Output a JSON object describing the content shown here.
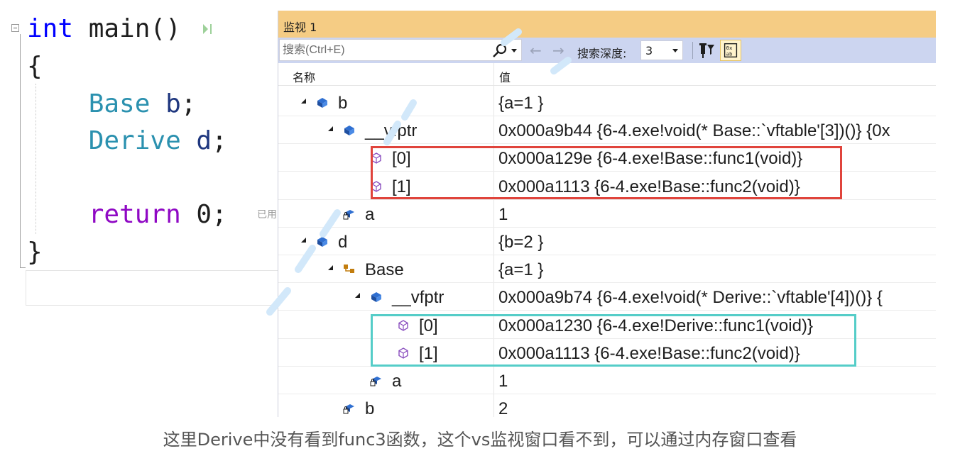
{
  "editor": {
    "lines": [
      {
        "parts": [
          {
            "t": "int",
            "c": "kw"
          },
          {
            "t": " main()",
            "c": "plain"
          }
        ]
      },
      {
        "parts": [
          {
            "t": "{",
            "c": "plain"
          }
        ]
      },
      {
        "parts": [
          {
            "t": "    Base",
            "c": "type"
          },
          {
            "t": " b",
            "c": "ident"
          },
          {
            "t": ";",
            "c": "plain"
          }
        ]
      },
      {
        "parts": [
          {
            "t": "    Derive",
            "c": "type"
          },
          {
            "t": " d",
            "c": "ident"
          },
          {
            "t": ";",
            "c": "plain"
          }
        ]
      },
      {
        "parts": [
          {
            "t": "",
            "c": "plain"
          }
        ]
      },
      {
        "parts": [
          {
            "t": "    return",
            "c": "kw2"
          },
          {
            "t": " 0;",
            "c": "plain"
          }
        ]
      },
      {
        "parts": [
          {
            "t": "}",
            "c": "plain"
          }
        ]
      }
    ],
    "hint_text": "已用"
  },
  "watch": {
    "title": "监视 1",
    "search": {
      "placeholder": "搜索(Ctrl+E)"
    },
    "search_depth_label": "搜索深度:",
    "search_depth_value": "3",
    "columns": {
      "name": "名称",
      "value": "值"
    },
    "rows": [
      {
        "indent": 0,
        "expanded": true,
        "icon": "object-icon",
        "name": "b",
        "value": "{a=1 }"
      },
      {
        "indent": 1,
        "expanded": true,
        "icon": "object-icon",
        "name": "__vfptr",
        "value": "0x000a9b44 {6-4.exe!void(* Base::`vftable'[3])()} {0x"
      },
      {
        "indent": 2,
        "expanded": null,
        "icon": "method-icon",
        "name": "[0]",
        "value": "0x000a129e {6-4.exe!Base::func1(void)}"
      },
      {
        "indent": 2,
        "expanded": null,
        "icon": "method-icon",
        "name": "[1]",
        "value": "0x000a1113 {6-4.exe!Base::func2(void)}"
      },
      {
        "indent": 1,
        "expanded": null,
        "icon": "field-icon",
        "name": "a",
        "value": "1"
      },
      {
        "indent": 0,
        "expanded": true,
        "icon": "object-icon",
        "name": "d",
        "value": "{b=2 }"
      },
      {
        "indent": 1,
        "expanded": true,
        "icon": "base-class-icon",
        "name": "Base",
        "value": "{a=1 }"
      },
      {
        "indent": 2,
        "expanded": true,
        "icon": "object-icon",
        "name": "__vfptr",
        "value": "0x000a9b74 {6-4.exe!void(* Derive::`vftable'[4])()} {"
      },
      {
        "indent": 3,
        "expanded": null,
        "icon": "method-icon",
        "name": "[0]",
        "value": "0x000a1230 {6-4.exe!Derive::func1(void)}"
      },
      {
        "indent": 3,
        "expanded": null,
        "icon": "method-icon",
        "name": "[1]",
        "value": "0x000a1113 {6-4.exe!Base::func2(void)}"
      },
      {
        "indent": 2,
        "expanded": null,
        "icon": "field-icon",
        "name": "a",
        "value": "1"
      },
      {
        "indent": 1,
        "expanded": null,
        "icon": "field-icon",
        "name": "b",
        "value": "2"
      }
    ]
  },
  "caption": "这里Derive中没有看到func3函数，这个vs监视窗口看不到，可以通过内存窗口查看",
  "colors": {
    "title_bar": "#f5cc84",
    "toolbar": "#ccd5f0",
    "highlight_red": "#e0443c",
    "highlight_cyan": "#55cdc8"
  }
}
